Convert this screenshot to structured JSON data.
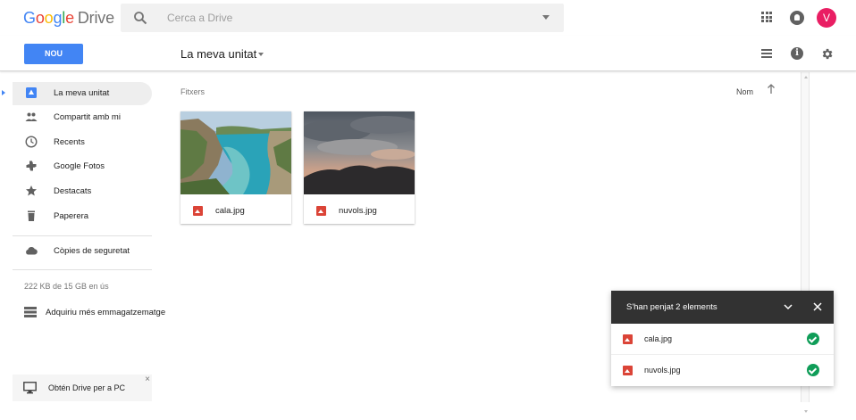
{
  "app": {
    "logo_letters": [
      "G",
      "o",
      "o",
      "g",
      "l",
      "e"
    ],
    "product": "Drive"
  },
  "search": {
    "placeholder": "Cerca a Drive",
    "value": ""
  },
  "account": {
    "avatar_letter": "V",
    "avatar_color": "#e91e63"
  },
  "toolbar": {
    "new_label": "NOU",
    "new_color": "#4285f4",
    "breadcrumb": "La meva unitat",
    "info_glyph": "i"
  },
  "sidebar": {
    "items": [
      {
        "label": "La meva unitat",
        "icon": "my-drive-icon",
        "active": true
      },
      {
        "label": "Compartit amb mi",
        "icon": "people-icon",
        "active": false
      },
      {
        "label": "Recents",
        "icon": "clock-icon",
        "active": false
      },
      {
        "label": "Google Fotos",
        "icon": "pinwheel-icon",
        "active": false
      },
      {
        "label": "Destacats",
        "icon": "star-icon",
        "active": false
      },
      {
        "label": "Paperera",
        "icon": "trash-icon",
        "active": false
      }
    ],
    "backups": {
      "label": "Còpies de seguretat",
      "icon": "cloud-icon"
    },
    "storage_text": "222 KB de 15 GB en ús",
    "buy_storage": "Adquiriu més emmagatzematge",
    "promo": {
      "label": "Obtén Drive per a PC",
      "close": "×"
    }
  },
  "main": {
    "section_label": "Fitxers",
    "sort_label": "Nom",
    "files": [
      {
        "name": "cala.jpg",
        "icon": "image-file-icon"
      },
      {
        "name": "nuvols.jpg",
        "icon": "image-file-icon"
      }
    ]
  },
  "upload_panel": {
    "title": "S'han penjat 2 elements",
    "items": [
      {
        "name": "cala.jpg",
        "status": "done"
      },
      {
        "name": "nuvols.jpg",
        "status": "done"
      }
    ],
    "success_color": "#0f9d58"
  }
}
